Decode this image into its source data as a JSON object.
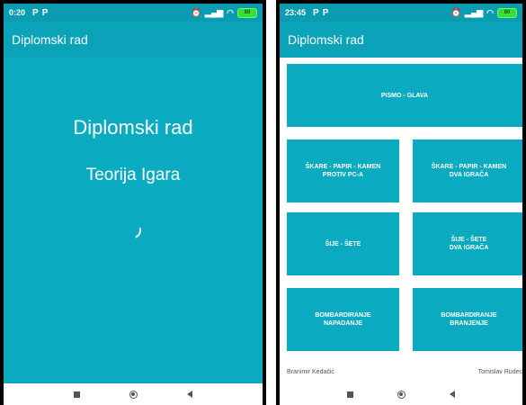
{
  "left_phone": {
    "status": {
      "time": "0:20",
      "p_icons": [
        "P",
        "P"
      ],
      "battery": "80"
    },
    "app_bar": {
      "title": "Diplomski rad"
    },
    "splash": {
      "title": "Diplomski rad",
      "subtitle": "Teorija Igara"
    },
    "nav": {
      "icons": [
        "square-icon",
        "circle-icon",
        "back-triangle-icon"
      ]
    }
  },
  "right_phone": {
    "status": {
      "time": "23:45",
      "p_icons": [
        "P",
        "P"
      ],
      "battery": "80"
    },
    "app_bar": {
      "title": "Diplomski rad"
    },
    "buttons": [
      {
        "label": "PISMO - GLAVA"
      },
      {
        "label": "ŠKARE - PAPIR - KAMEN\nPROTIV PC-A"
      },
      {
        "label": "ŠKARE - PAPIR - KAMEN\nDVA IGRAČA"
      },
      {
        "label": "ŠIJE - ŠETE"
      },
      {
        "label": "ŠIJE - ŠETE\nDVA IGRAČA"
      },
      {
        "label": "BOMBARDIRANJE\nNAPADANJE"
      },
      {
        "label": "BOMBARDIRANJE\nBRANJENJE"
      }
    ],
    "footer": {
      "left": "Branimir Kedačić",
      "right": "Tomislav Rudec"
    },
    "nav": {
      "icons": [
        "square-icon",
        "circle-icon",
        "back-triangle-icon"
      ]
    }
  },
  "colors": {
    "primary": "#0aabc1",
    "app_bar": "#0aa3b9",
    "status_bar": "#0a9db2"
  }
}
